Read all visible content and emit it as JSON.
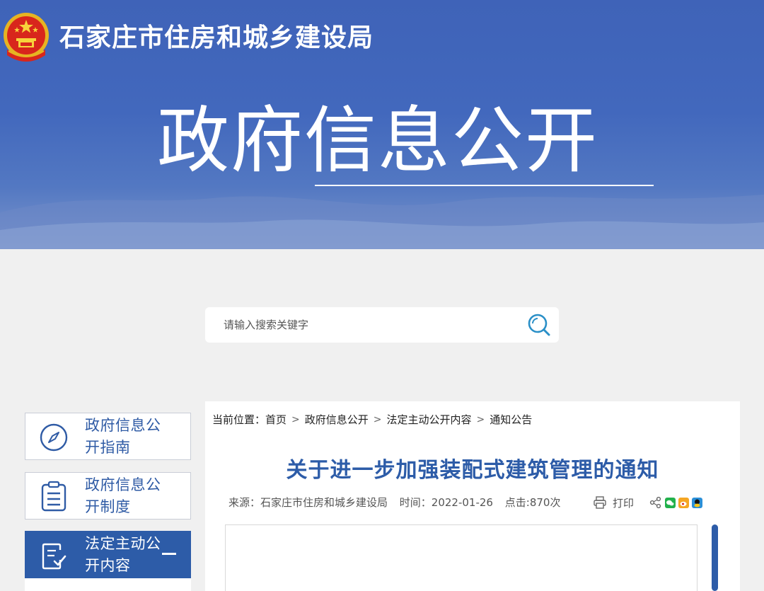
{
  "header": {
    "site_title": "石家庄市住房和城乡建设局",
    "banner_title": "政府信息公开"
  },
  "search": {
    "placeholder": "请输入搜索关键字",
    "icon": "search-icon"
  },
  "sidebar": {
    "items": [
      {
        "label": "政府信息公开指南",
        "icon": "compass-icon",
        "active": false
      },
      {
        "label": "政府信息公开制度",
        "icon": "clipboard-list-icon",
        "active": false
      },
      {
        "label": "法定主动公开内容",
        "icon": "document-check-icon",
        "active": true,
        "expanded": true
      }
    ]
  },
  "breadcrumb": {
    "lead": "当前位置：",
    "items": [
      "首页",
      "政府信息公开",
      "法定主动公开内容",
      "通知公告"
    ]
  },
  "article": {
    "title": "关于进一步加强装配式建筑管理的通知",
    "source": "来源：石家庄市住房和城乡建设局",
    "time": "时间：2022-01-26",
    "hits": "点击:870次",
    "print_label": "打印"
  },
  "colors": {
    "brand_blue": "#2d5ca8",
    "banner_blue": "#4268bd",
    "wechat_green": "#22b14c",
    "weibo_orange": "#f5a623",
    "qq_blue": "#2a8fd8"
  }
}
